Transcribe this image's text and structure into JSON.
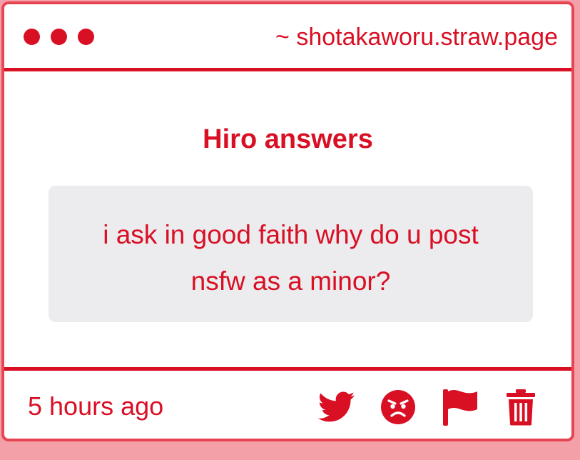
{
  "window": {
    "url": "~ shotakaworu.straw.page"
  },
  "post": {
    "heading": "Hiro answers",
    "question": "i ask in good faith why do u post nsfw as a minor?"
  },
  "footer": {
    "timestamp": "5 hours ago",
    "actions": [
      {
        "icon": "twitter-bird-icon"
      },
      {
        "icon": "angry-face-icon"
      },
      {
        "icon": "flag-icon"
      },
      {
        "icon": "trash-icon"
      }
    ]
  },
  "colors": {
    "accent": "#d90f24",
    "frame": "#e84552",
    "outer_background": "#f4a0a8",
    "question_background": "#ececee",
    "panel_background": "#ffffff"
  }
}
